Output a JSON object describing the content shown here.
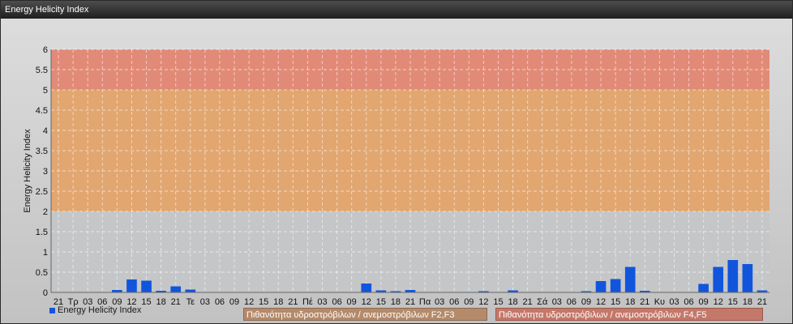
{
  "window": {
    "title": "Energy Helicity Index"
  },
  "legend": {
    "series_label": "Energy Helicity Index",
    "band_low_label": "Πιθανότητα υδροστρόβιλων / ανεμοστρόβιλων F2,F3",
    "band_high_label": "Πιθανότητα υδροστρόβιλων / ανεμοστρόβιλων F4,F5"
  },
  "chart_data": {
    "type": "bar",
    "title": "",
    "xlabel": "",
    "ylabel": "Energy Helicity Index",
    "ylim": [
      0,
      6
    ],
    "yticks": [
      0,
      0.5,
      1,
      1.5,
      2,
      2.5,
      3,
      3.5,
      4,
      4.5,
      5,
      5.5,
      6
    ],
    "grid": true,
    "legend_position": "bottom-left",
    "bar_color": "#1155dd",
    "bands": [
      {
        "from": 2,
        "to": 5,
        "color": "#e8a060"
      },
      {
        "from": 5,
        "to": 6,
        "color": "#e87f6a"
      }
    ],
    "categories": [
      "21",
      "Τρ",
      "03",
      "06",
      "09",
      "12",
      "15",
      "18",
      "21",
      "Τε",
      "03",
      "06",
      "09",
      "12",
      "15",
      "18",
      "21",
      "Πέ",
      "03",
      "06",
      "09",
      "12",
      "15",
      "18",
      "21",
      "Πα",
      "03",
      "06",
      "09",
      "12",
      "15",
      "18",
      "21",
      "Σά",
      "03",
      "06",
      "09",
      "12",
      "15",
      "18",
      "21",
      "Κυ",
      "03",
      "06",
      "09",
      "12",
      "15",
      "18",
      "21"
    ],
    "series": [
      {
        "name": "Energy Helicity Index",
        "values": [
          0.01,
          0.01,
          0.01,
          0.01,
          0.06,
          0.32,
          0.29,
          0.04,
          0.15,
          0.07,
          0.01,
          0.01,
          0.01,
          0.01,
          0.01,
          0.01,
          0.01,
          0.01,
          0.01,
          0.01,
          0.01,
          0.22,
          0.05,
          0.03,
          0.06,
          0.01,
          0.01,
          0.01,
          0.01,
          0.03,
          0.01,
          0.05,
          0.01,
          0.01,
          0.01,
          0.01,
          0.03,
          0.28,
          0.33,
          0.63,
          0.04,
          0.01,
          0.01,
          0.01,
          0.21,
          0.63,
          0.8,
          0.7,
          0.05
        ]
      }
    ]
  }
}
